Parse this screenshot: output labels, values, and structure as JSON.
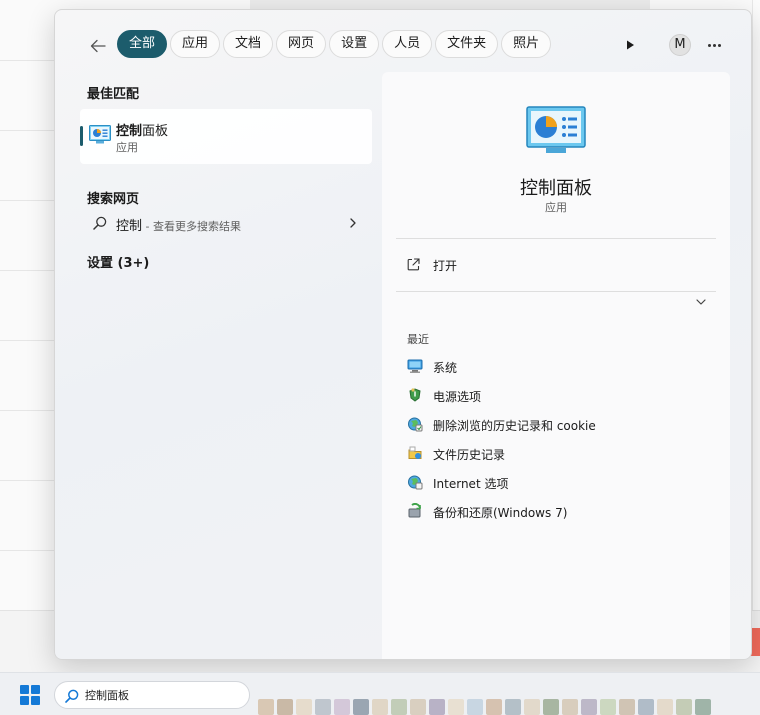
{
  "filter_bar": {
    "chips": [
      {
        "label": "全部",
        "active": true
      },
      {
        "label": "应用",
        "active": false
      },
      {
        "label": "文档",
        "active": false
      },
      {
        "label": "网页",
        "active": false
      },
      {
        "label": "设置",
        "active": false
      },
      {
        "label": "人员",
        "active": false
      },
      {
        "label": "文件夹",
        "active": false
      },
      {
        "label": "照片",
        "active": false
      }
    ],
    "avatar_letter": "M"
  },
  "left_panel": {
    "best_match_title": "最佳匹配",
    "best_match": {
      "name_match": "控制",
      "name_rest": "面板",
      "type": "应用"
    },
    "web_title": "搜索网页",
    "web_result": {
      "query": "控制",
      "hint": " - 查看更多搜索结果"
    },
    "settings_title": "设置 (3+)"
  },
  "right_panel": {
    "app_name": "控制面板",
    "app_type": "应用",
    "open_label": "打开",
    "recent_title": "最近",
    "recent_items": [
      {
        "label": "系统",
        "icon": "system-monitor-icon"
      },
      {
        "label": "电源选项",
        "icon": "power-options-icon"
      },
      {
        "label": "删除浏览的历史记录和 cookie",
        "icon": "internet-globe-icon"
      },
      {
        "label": "文件历史记录",
        "icon": "file-history-icon"
      },
      {
        "label": "Internet 选项",
        "icon": "internet-globe-icon"
      },
      {
        "label": "备份和还原(Windows 7)",
        "icon": "backup-restore-icon"
      }
    ]
  },
  "taskbar": {
    "search_value": "控制面板"
  },
  "colors": {
    "accent": "#1c5c6c",
    "start_blue": "#1479d6"
  }
}
